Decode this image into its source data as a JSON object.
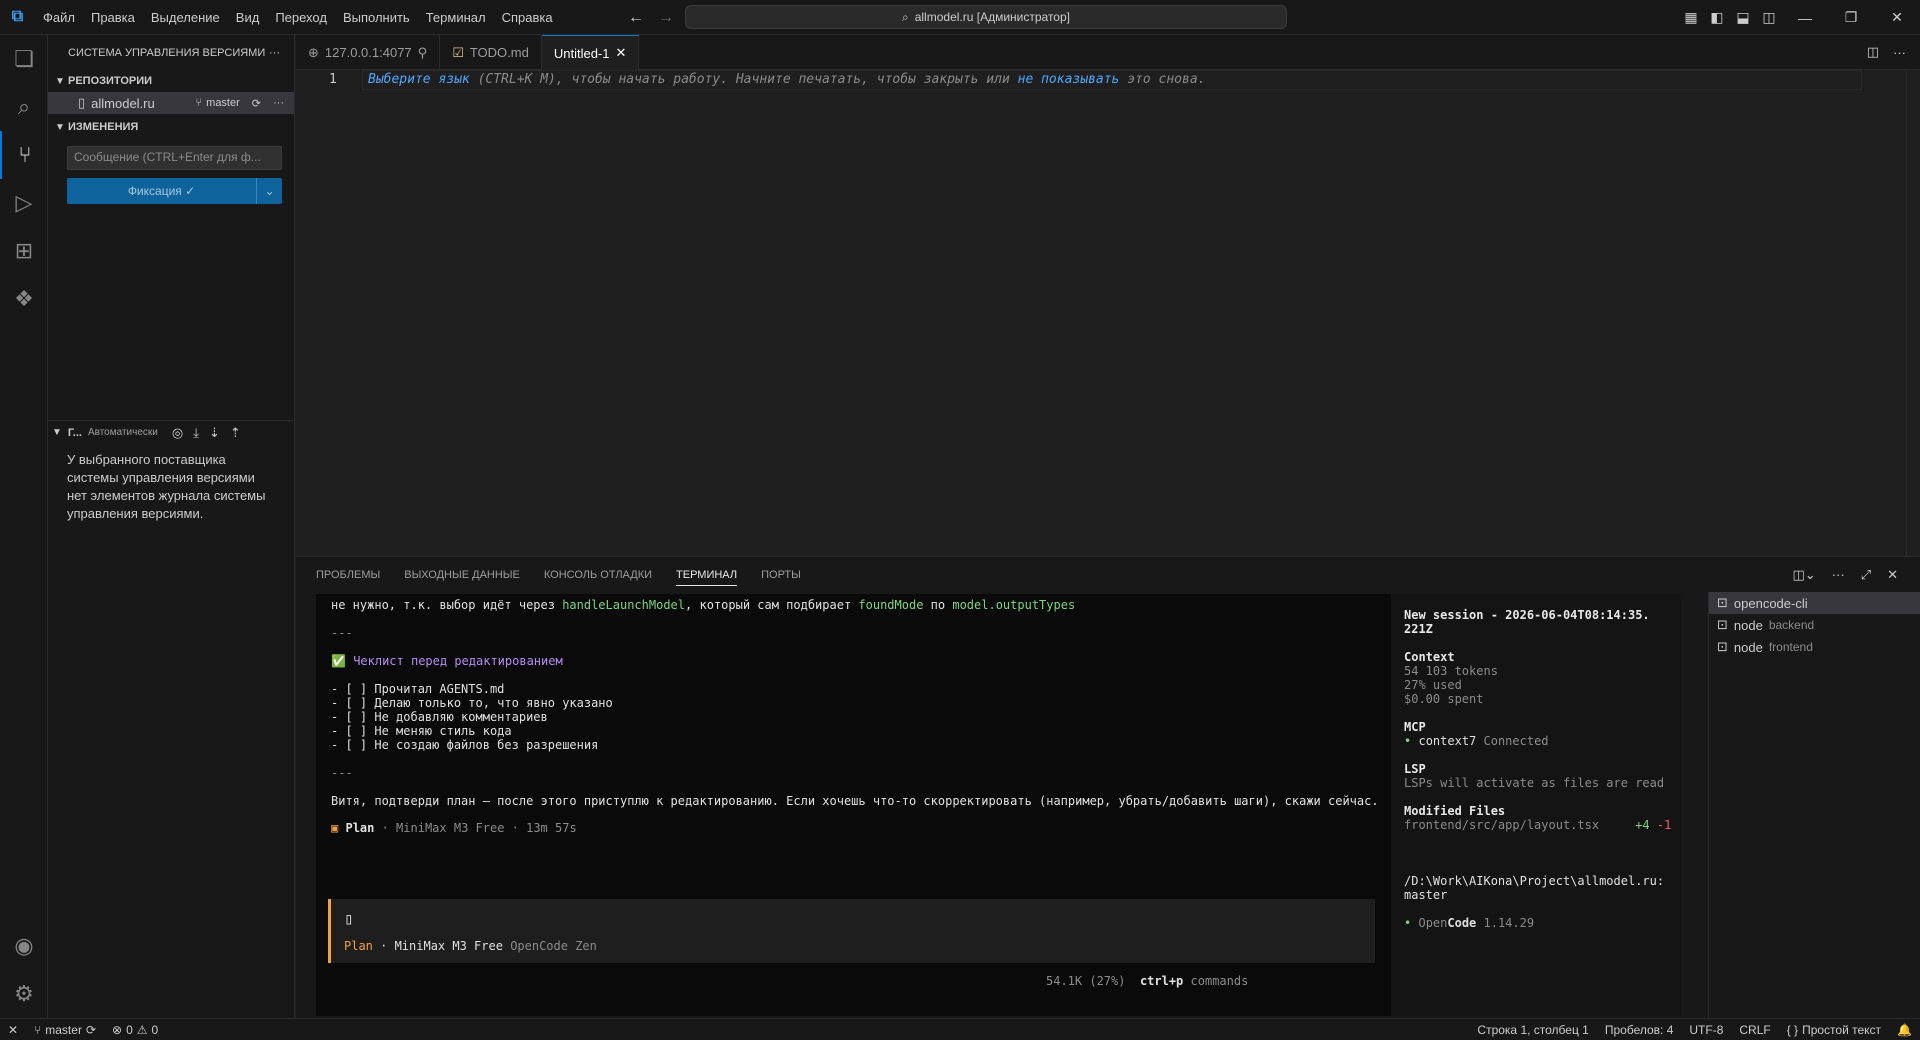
{
  "titlebar": {
    "menu": [
      "Файл",
      "Правка",
      "Выделение",
      "Вид",
      "Переход",
      "Выполнить",
      "Терминал",
      "Справка"
    ],
    "search": "allmodel.ru [Администратор]"
  },
  "sidebar": {
    "title": "СИСТЕМА УПРАВЛЕНИЯ ВЕРСИЯМИ",
    "repos_header": "РЕПОЗИТОРИИ",
    "repo_name": "allmodel.ru",
    "repo_branch": "master",
    "changes_header": "ИЗМЕНЕНИЯ",
    "commit_placeholder": "Сообщение (CTRL+Enter для ф...",
    "commit_button": "Фиксация ✓",
    "graph_header": "Г...",
    "graph_auto": "Автоматически",
    "graph_message": "У выбранного поставщика системы управления версиями нет элементов журнала системы управления версиями."
  },
  "tabs": [
    {
      "label": "127.0.0.1:4077",
      "icon": "globe-icon"
    },
    {
      "label": "TODO.md",
      "icon": "todo-icon"
    },
    {
      "label": "Untitled-1",
      "icon": "none"
    }
  ],
  "editor": {
    "line_number": "1",
    "hint_link1": "Выберите язык",
    "hint_mid": " (CTRL+K M), чтобы начать работу. Начните печатать, чтобы закрыть или ",
    "hint_link2": "не показывать",
    "hint_end": " это снова."
  },
  "panel": {
    "tabs": [
      "ПРОБЛЕМЫ",
      "ВЫХОДНЫЕ ДАННЫЕ",
      "КОНСОЛЬ ОТЛАДКИ",
      "ТЕРМИНАЛ",
      "ПОРТЫ"
    ]
  },
  "terminal": {
    "l1a": "не нужно, т.к. выбор идёт через ",
    "l1b": "handleLaunchModel",
    "l1c": ", который сам подбирает ",
    "l1d": "foundMode",
    "l1e": " по ",
    "l1f": "model.outputTypes",
    "sep1": "---",
    "checklist_title": "Чеклист перед редактированием",
    "checklist": [
      "- [ ] Прочитал AGENTS.md",
      "- [ ] Делаю только то, что явно указано",
      "- [ ] Не добавляю комментариев",
      "- [ ] Не меняю стиль кода",
      "- [ ] Не создаю файлов без разрешения"
    ],
    "sep2": "---",
    "question": "Витя, подтверди план — после этого приступлю к редактированию. Если хочешь что-то скорректировать (например, убрать/добавить шаги), скажи сейчас.",
    "plan_mode": "Plan",
    "plan_meta": " · MiniMax M3 Free · 13m 57s",
    "cursor": "▯",
    "footer_mode": "Plan",
    "footer_model": " · MiniMax M3 Free ",
    "footer_provider": "OpenCode Zen",
    "usage": "54.1K (27%)",
    "shortcut": "ctrl+p",
    "shortcut_label": " commands"
  },
  "session": {
    "title1": "New session - 2026-06-04T08:14:35.",
    "title2": "221Z",
    "context_h": "Context",
    "tokens": "54 103 tokens",
    "used": "27% used",
    "spent": "$0.00 spent",
    "mcp_h": "MCP",
    "mcp_name": "context7",
    "mcp_status": " Connected",
    "lsp_h": "LSP",
    "lsp_msg": "LSPs will activate as files are read",
    "mod_h": "Modified Files",
    "mod_file": "frontend/src/app/layout.tsx",
    "mod_add": "+4",
    "mod_del": "-1",
    "path1": "/D:\\Work\\AIKona\\Project\\allmodel.ru:",
    "path2": "master",
    "version_a": "Open",
    "version_b": "Code",
    "version_num": " 1.14.29"
  },
  "termlist": [
    {
      "name": "opencode-cli",
      "sub": ""
    },
    {
      "name": "node",
      "sub": "backend"
    },
    {
      "name": "node",
      "sub": "frontend"
    }
  ],
  "status": {
    "branch": "master",
    "errors": "0",
    "warnings": "0",
    "position": "Строка 1, столбец 1",
    "spaces": "Пробелов: 4",
    "encoding": "UTF-8",
    "eol": "CRLF",
    "language": "Простой текст"
  }
}
